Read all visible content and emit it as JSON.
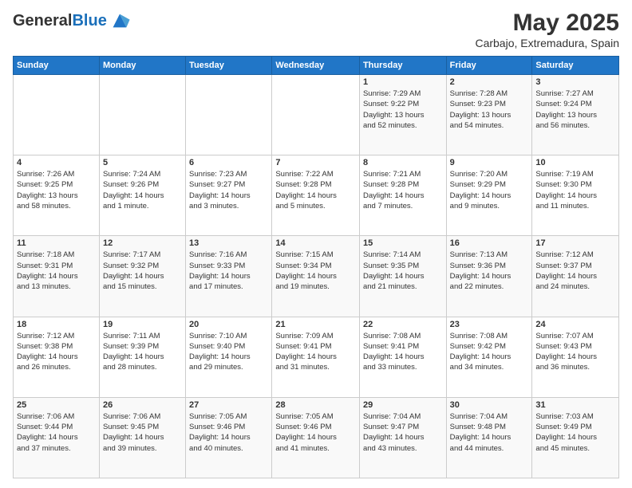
{
  "header": {
    "logo_line1": "General",
    "logo_line2": "Blue",
    "title": "May 2025",
    "subtitle": "Carbajo, Extremadura, Spain"
  },
  "weekdays": [
    "Sunday",
    "Monday",
    "Tuesday",
    "Wednesday",
    "Thursday",
    "Friday",
    "Saturday"
  ],
  "weeks": [
    [
      {
        "day": "",
        "info": ""
      },
      {
        "day": "",
        "info": ""
      },
      {
        "day": "",
        "info": ""
      },
      {
        "day": "",
        "info": ""
      },
      {
        "day": "1",
        "info": "Sunrise: 7:29 AM\nSunset: 9:22 PM\nDaylight: 13 hours\nand 52 minutes."
      },
      {
        "day": "2",
        "info": "Sunrise: 7:28 AM\nSunset: 9:23 PM\nDaylight: 13 hours\nand 54 minutes."
      },
      {
        "day": "3",
        "info": "Sunrise: 7:27 AM\nSunset: 9:24 PM\nDaylight: 13 hours\nand 56 minutes."
      }
    ],
    [
      {
        "day": "4",
        "info": "Sunrise: 7:26 AM\nSunset: 9:25 PM\nDaylight: 13 hours\nand 58 minutes."
      },
      {
        "day": "5",
        "info": "Sunrise: 7:24 AM\nSunset: 9:26 PM\nDaylight: 14 hours\nand 1 minute."
      },
      {
        "day": "6",
        "info": "Sunrise: 7:23 AM\nSunset: 9:27 PM\nDaylight: 14 hours\nand 3 minutes."
      },
      {
        "day": "7",
        "info": "Sunrise: 7:22 AM\nSunset: 9:28 PM\nDaylight: 14 hours\nand 5 minutes."
      },
      {
        "day": "8",
        "info": "Sunrise: 7:21 AM\nSunset: 9:28 PM\nDaylight: 14 hours\nand 7 minutes."
      },
      {
        "day": "9",
        "info": "Sunrise: 7:20 AM\nSunset: 9:29 PM\nDaylight: 14 hours\nand 9 minutes."
      },
      {
        "day": "10",
        "info": "Sunrise: 7:19 AM\nSunset: 9:30 PM\nDaylight: 14 hours\nand 11 minutes."
      }
    ],
    [
      {
        "day": "11",
        "info": "Sunrise: 7:18 AM\nSunset: 9:31 PM\nDaylight: 14 hours\nand 13 minutes."
      },
      {
        "day": "12",
        "info": "Sunrise: 7:17 AM\nSunset: 9:32 PM\nDaylight: 14 hours\nand 15 minutes."
      },
      {
        "day": "13",
        "info": "Sunrise: 7:16 AM\nSunset: 9:33 PM\nDaylight: 14 hours\nand 17 minutes."
      },
      {
        "day": "14",
        "info": "Sunrise: 7:15 AM\nSunset: 9:34 PM\nDaylight: 14 hours\nand 19 minutes."
      },
      {
        "day": "15",
        "info": "Sunrise: 7:14 AM\nSunset: 9:35 PM\nDaylight: 14 hours\nand 21 minutes."
      },
      {
        "day": "16",
        "info": "Sunrise: 7:13 AM\nSunset: 9:36 PM\nDaylight: 14 hours\nand 22 minutes."
      },
      {
        "day": "17",
        "info": "Sunrise: 7:12 AM\nSunset: 9:37 PM\nDaylight: 14 hours\nand 24 minutes."
      }
    ],
    [
      {
        "day": "18",
        "info": "Sunrise: 7:12 AM\nSunset: 9:38 PM\nDaylight: 14 hours\nand 26 minutes."
      },
      {
        "day": "19",
        "info": "Sunrise: 7:11 AM\nSunset: 9:39 PM\nDaylight: 14 hours\nand 28 minutes."
      },
      {
        "day": "20",
        "info": "Sunrise: 7:10 AM\nSunset: 9:40 PM\nDaylight: 14 hours\nand 29 minutes."
      },
      {
        "day": "21",
        "info": "Sunrise: 7:09 AM\nSunset: 9:41 PM\nDaylight: 14 hours\nand 31 minutes."
      },
      {
        "day": "22",
        "info": "Sunrise: 7:08 AM\nSunset: 9:41 PM\nDaylight: 14 hours\nand 33 minutes."
      },
      {
        "day": "23",
        "info": "Sunrise: 7:08 AM\nSunset: 9:42 PM\nDaylight: 14 hours\nand 34 minutes."
      },
      {
        "day": "24",
        "info": "Sunrise: 7:07 AM\nSunset: 9:43 PM\nDaylight: 14 hours\nand 36 minutes."
      }
    ],
    [
      {
        "day": "25",
        "info": "Sunrise: 7:06 AM\nSunset: 9:44 PM\nDaylight: 14 hours\nand 37 minutes."
      },
      {
        "day": "26",
        "info": "Sunrise: 7:06 AM\nSunset: 9:45 PM\nDaylight: 14 hours\nand 39 minutes."
      },
      {
        "day": "27",
        "info": "Sunrise: 7:05 AM\nSunset: 9:46 PM\nDaylight: 14 hours\nand 40 minutes."
      },
      {
        "day": "28",
        "info": "Sunrise: 7:05 AM\nSunset: 9:46 PM\nDaylight: 14 hours\nand 41 minutes."
      },
      {
        "day": "29",
        "info": "Sunrise: 7:04 AM\nSunset: 9:47 PM\nDaylight: 14 hours\nand 43 minutes."
      },
      {
        "day": "30",
        "info": "Sunrise: 7:04 AM\nSunset: 9:48 PM\nDaylight: 14 hours\nand 44 minutes."
      },
      {
        "day": "31",
        "info": "Sunrise: 7:03 AM\nSunset: 9:49 PM\nDaylight: 14 hours\nand 45 minutes."
      }
    ]
  ]
}
